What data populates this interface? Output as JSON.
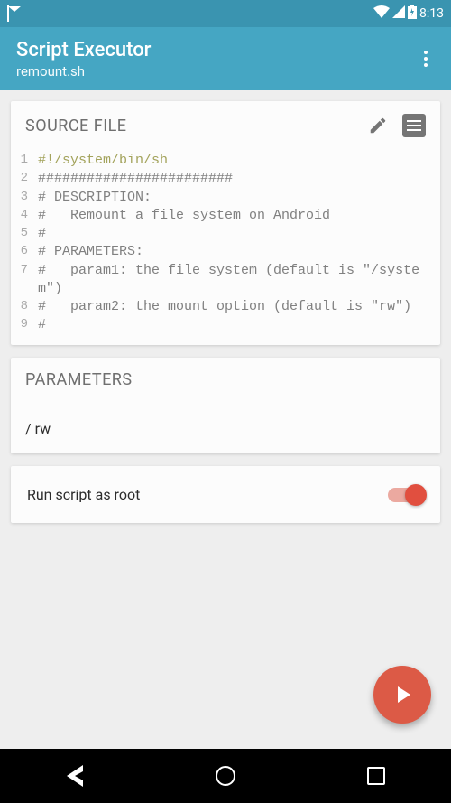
{
  "statusbar": {
    "time": "8:13"
  },
  "appbar": {
    "title": "Script Executor",
    "subtitle": "remount.sh"
  },
  "source": {
    "header": "SOURCE FILE",
    "lines": [
      {
        "n": "1",
        "txt": "#!/system/bin/sh",
        "cls": "shebang"
      },
      {
        "n": "2",
        "txt": "########################"
      },
      {
        "n": "3",
        "txt": "# DESCRIPTION:"
      },
      {
        "n": "4",
        "txt": "#   Remount a file system on Android"
      },
      {
        "n": "5",
        "txt": "#"
      },
      {
        "n": "6",
        "txt": "# PARAMETERS:"
      },
      {
        "n": "7",
        "txt": "#   param1: the file system (default is \"/system\")"
      },
      {
        "n": "8",
        "txt": "#   param2: the mount option (default is \"rw\")"
      },
      {
        "n": "9",
        "txt": "#"
      }
    ]
  },
  "parameters": {
    "header": "PARAMETERS",
    "value": "/ rw"
  },
  "runroot": {
    "label": "Run script as root",
    "enabled": true
  },
  "colors": {
    "accent": "#45a6c3",
    "fab": "#dc5a46"
  }
}
